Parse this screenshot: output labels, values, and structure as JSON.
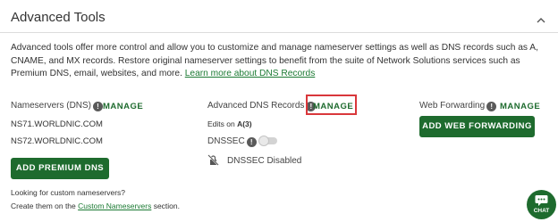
{
  "section": {
    "title": "Advanced Tools",
    "description_text": "Advanced tools offer more control and allow you to customize and manage nameserver settings as well as DNS records such as A, CNAME, and MX records. Restore original nameserver settings to benefit from the suite of Network Solutions services such as Premium DNS, email, websites, and more. ",
    "learn_more_link": "Learn more about DNS Records"
  },
  "nameservers": {
    "label": "Nameservers (DNS)",
    "manage_label": "MANAGE",
    "servers": [
      "NS71.WORLDNIC.COM",
      "NS72.WORLDNIC.COM"
    ],
    "button_label": "ADD PREMIUM DNS",
    "custom_question": "Looking for custom nameservers?",
    "custom_prefix": "Create them on the ",
    "custom_link": "Custom Nameservers",
    "custom_suffix": " section."
  },
  "advanced_dns": {
    "label": "Advanced DNS Records",
    "manage_label": "MANAGE",
    "edits_prefix": "Edits on ",
    "edits_value": "A(3)",
    "dnssec_label": "DNSSEC",
    "dnssec_status": "DNSSEC Disabled"
  },
  "web_forwarding": {
    "label": "Web Forwarding",
    "manage_label": "MANAGE",
    "button_label": "ADD WEB FORWARDING"
  },
  "chat": {
    "label": "CHAT"
  },
  "colors": {
    "brand_green": "#1e6b2e",
    "link_green": "#1b7a33",
    "highlight_red": "#d9373b"
  }
}
